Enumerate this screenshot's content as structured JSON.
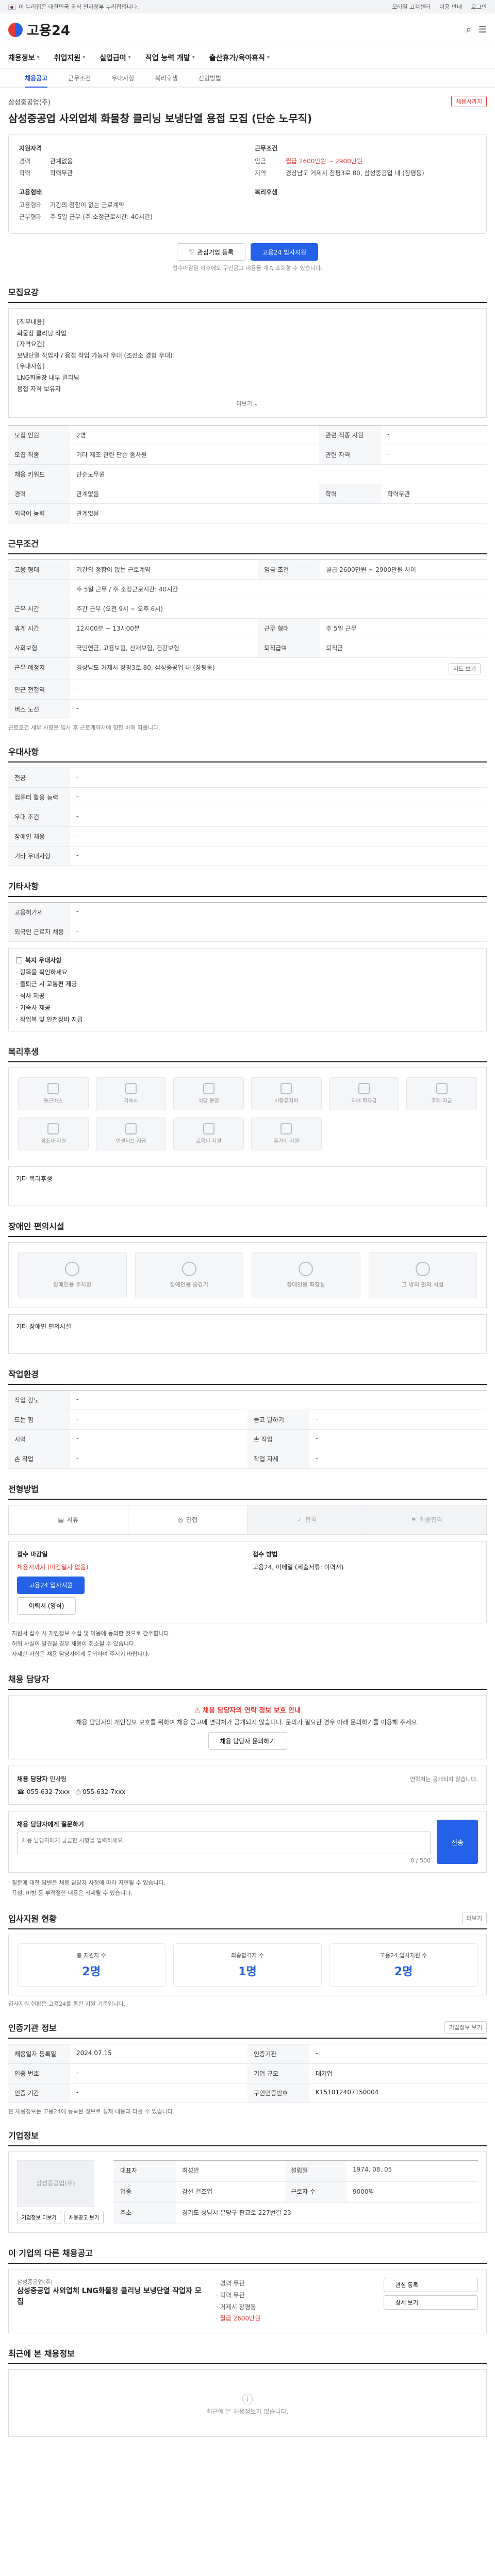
{
  "gov_bar": {
    "text": "이 누리집은 대한민국 공식 전자정부 누리집입니다.",
    "links": [
      "모바일 고객센터",
      "이용 안내",
      "로그인"
    ]
  },
  "header": {
    "logo_text": "고용24"
  },
  "nav": {
    "items": [
      "채용정보",
      "취업지원",
      "실업급여",
      "직업 능력 개발",
      "출산휴가/육아휴직"
    ]
  },
  "subnav": {
    "items": [
      "채용공고",
      "근무조건",
      "우대사항",
      "복리후생",
      "전형방법"
    ]
  },
  "posting": {
    "company": "삼성중공업(주)",
    "badge": "채용시까지",
    "title": "삼성중공업 사외업체 화물창 클리닝 보냉단열 용접 모집 (단순 노무직)",
    "qual_title": "지원자격",
    "qual": [
      {
        "k": "경력",
        "v": "관계없음"
      },
      {
        "k": "학력",
        "v": "학력무관"
      }
    ],
    "work_title": "근무조건",
    "work": [
      {
        "k": "임금",
        "v": "월급 2600만원 ~ 2900만원"
      },
      {
        "k": "지역",
        "v": "경상남도 거제시 장평3로 80, 삼성중공업 내 (장평동)"
      }
    ],
    "type_title": "고용형태",
    "type": [
      {
        "k": "고용형태",
        "v": "기간의 정함이 없는 근로계약"
      },
      {
        "k": "근무형태",
        "v": "주 5일 근무 (주 소정근로시간: 40시간)"
      }
    ],
    "welfare_title": "복리후생",
    "btn_interest": "관심기업 등록",
    "btn_apply": "고용24 입사지원",
    "apply_note": "접수마감일 이후에도 구인공고 내용을 계속 조회할 수 있습니다.",
    "section_recruit": "모집요강",
    "job_desc": [
      "[직무내용]",
      "화물창 클리닝 작업",
      "",
      "[자격요건]",
      "보냉단열 작업자 / 용접 작업 가능자 우대 (조선소 경험 우대)",
      "",
      "[우대사항]",
      "LNG화물창 내부 클리닝",
      "용접 자격 보유자"
    ],
    "fold": "더보기",
    "recruit_rows": [
      {
        "k": "모집 인원",
        "v": "2명",
        "k2": "관련 직종 지원",
        "v2": "-"
      },
      {
        "k": "모집 직종",
        "v": "기타 제조 관련 단순 종사원",
        "k2": "관련 자격",
        "v2": "-"
      },
      {
        "k": "채용 키워드",
        "v": "단순노무원",
        "k2": "",
        "v2": ""
      },
      {
        "k": "경력",
        "v": "관계없음",
        "k2": "학력",
        "v2": "학력무관"
      },
      {
        "k": "외국어 능력",
        "v": "관계없음",
        "k2": "",
        "v2": ""
      }
    ],
    "section_work": "근무조건",
    "work_rows": [
      {
        "k": "고용 형태",
        "v": "기간의 정함이 없는 근로계약",
        "k2": "임금 조건",
        "v2": "월급 2600만원 ~ 2900만원 사이"
      },
      {
        "k": "",
        "v": "주 5일 근무 / 주 소정근로시간: 40시간",
        "k2": "",
        "v2": ""
      },
      {
        "k": "근무 시간",
        "v": "주간 근무 (오전 9시 ~ 오후 6시)",
        "k2": "",
        "v2": ""
      },
      {
        "k": "휴게 시간",
        "v": "12시00분 ~ 13시00분",
        "k2": "근무 형태",
        "v2": "주 5일 근무"
      },
      {
        "k": "사회보험",
        "v": "국민연금, 고용보험, 산재보험, 건강보험",
        "k2": "퇴직급여",
        "v2": "퇴직금"
      },
      {
        "k": "근무 예정지",
        "v": "경상남도 거제시 장평3로 80, 삼성중공업 내 (장평동)",
        "k2": "",
        "v2": ""
      },
      {
        "k": "인근 전철역",
        "v": "-",
        "k2": "",
        "v2": ""
      },
      {
        "k": "버스 노선",
        "v": "-",
        "k2": "",
        "v2": ""
      }
    ],
    "work_note": "근로조건 세부 사항은 입사 후 근로계약서에 정한 바에 따릅니다.",
    "map_btn": "지도 보기",
    "section_pref": "우대사항",
    "pref_rows": [
      {
        "k": "전공",
        "v": "-"
      },
      {
        "k": "컴퓨터 활용 능력",
        "v": "-"
      },
      {
        "k": "우대 조건",
        "v": "-"
      },
      {
        "k": "장애인 채용",
        "v": "-"
      },
      {
        "k": "기타 우대사항",
        "v": "-"
      }
    ],
    "section_etc": "기타사항",
    "etc_rows": [
      {
        "k": "고용허가제",
        "v": "-"
      },
      {
        "k": "외국인 근로자 채용",
        "v": "-"
      }
    ],
    "etc_checks_title": "복지 우대사항",
    "etc_checks": [
      "항목을 확인하세요",
      "출퇴근 시 교통편 제공",
      "식사 제공",
      "기숙사 제공",
      "작업복 및 안전장비 지급"
    ],
    "section_welfare": "복리후생",
    "welfare_icons": [
      "통근버스",
      "기숙사",
      "식당 운영",
      "차량유지비",
      "자녀 학자금",
      "주택 자금",
      "경조사 지원",
      "인센티브 지급",
      "교육비 지원",
      "휴가비 지원",
      "",
      ""
    ],
    "welfare_etc": "기타 복리후생",
    "section_disabled": "장애인 편의시설",
    "disabled_icons": [
      "장애인용 주차장",
      "장애인용 승강기",
      "장애인용 화장실",
      "그 밖의 편의 시설"
    ],
    "disabled_etc": "기타 장애인 편의시설",
    "section_workplace": "작업환경",
    "workplace_rows": [
      {
        "k": "작업 강도",
        "v": "-",
        "k2": "",
        "v2": ""
      },
      {
        "k": "드는 힘",
        "v": "-",
        "k2": "듣고 말하기",
        "v2": "-"
      },
      {
        "k": "시력",
        "v": "-",
        "k2": "손 작업",
        "v2": "-"
      },
      {
        "k": "손 작업",
        "v": "-",
        "k2": "작업 자세",
        "v2": "-"
      }
    ],
    "section_process": "전형방법",
    "steps": [
      "서류",
      "면접",
      "합격",
      "최종합격"
    ],
    "apply_method_title": "접수 마감일",
    "apply_deadline": "채용시까지 (마감일자 없음)",
    "apply_doc_title": "접수 방법",
    "apply_doc": "고용24, 이메일 (제출서류: 이력서)",
    "apply_btn": "고용24 입사지원",
    "apply_form": "이력서 (양식)",
    "apply_bullets": [
      "지원서 접수 시 개인정보 수집 및 이용에 동의한 것으로 간주합니다.",
      "허위 사실이 발견될 경우 채용이 취소될 수 있습니다.",
      "자세한 사항은 채용 담당자에게 문의하여 주시기 바랍니다."
    ],
    "section_contact": "채용 담당자",
    "alert_title": "채용 담당자의 연락 정보 보호 안내",
    "alert_body": "채용 담당자의 개인정보 보호를 위하여 채용 공고에 연락처가 공개되지 않습니다. 문의가 필요한 경우 아래 문의하기를 이용해 주세요.",
    "alert_btn": "채용 담당자 문의하기",
    "contact_name_label": "채용 담당자",
    "contact_name": "인사팀",
    "contact_phone": "055-632-7xxx",
    "contact_fax": "055-632-7xxx",
    "contact_note": "연락처는 공개되지 않습니다.",
    "q_label": "채용 담당자에게 질문하기",
    "q_placeholder": "채용 담당자에게 궁금한 사항을 입력하세요.",
    "q_send": "전송",
    "q_count": "0 / 500",
    "q_notes": [
      "질문에 대한 답변은 채용 담당자 사정에 따라 지연될 수 있습니다.",
      "욕설, 비방 등 부적절한 내용은 삭제될 수 있습니다."
    ],
    "section_status": "입사지원 현황",
    "status_more": "더보기",
    "stats": [
      {
        "label": "총 지원자 수",
        "n": "2명"
      },
      {
        "label": "최종합격자 수",
        "n": "1명"
      },
      {
        "label": "고용24 입사지원 수",
        "n": "2명"
      }
    ],
    "status_note": "입사지원 현황은 고용24를 통한 지원 기준입니다.",
    "section_info": "인증기관 정보",
    "info_btn": "기업정보 보기",
    "info": [
      {
        "th": "채용일자 등록일",
        "v": "2024.07.15",
        "th2": "인증기관",
        "v2": "-"
      },
      {
        "th": "인증 번호",
        "v": "-",
        "th2": "기업 규모",
        "v2": "대기업"
      },
      {
        "th": "인증 기간",
        "v": "-",
        "th2": "구인인증번호",
        "v2": "K151012407150004"
      }
    ],
    "info_note": "본 채용정보는 고용24에 등록된 정보로 실제 내용과 다를 수 있습니다.",
    "section_company": "기업정보",
    "company_name": "삼성중공업(주)",
    "company_rows": [
      {
        "k": "대표자",
        "v": "최성안",
        "k2": "설립일",
        "v2": "1974. 08. 05"
      },
      {
        "k": "업종",
        "v": "강선 건조업",
        "k2": "근로자 수",
        "v2": "9000명"
      },
      {
        "k": "주소",
        "v": "경기도 성남시 분당구 판교로 227번길 23",
        "k2": "",
        "v2": ""
      }
    ],
    "company_btns": [
      "기업정보 더보기",
      "채용공고 보기"
    ],
    "section_similar": "이 기업의 다른 채용공고",
    "similar_title": "삼성중공업 사외업체 LNG화물창 클리닝 보냉단열 작업자 모집",
    "similar_meta": [
      "경력 무관",
      "학력 무관",
      "거제시 장평동",
      "월급 2600만원"
    ],
    "similar_btns": [
      "관심 등록",
      "상세 보기"
    ],
    "section_recent": "최근에 본 채용정보",
    "recent_empty": "최근에 본 채용정보가 없습니다."
  }
}
